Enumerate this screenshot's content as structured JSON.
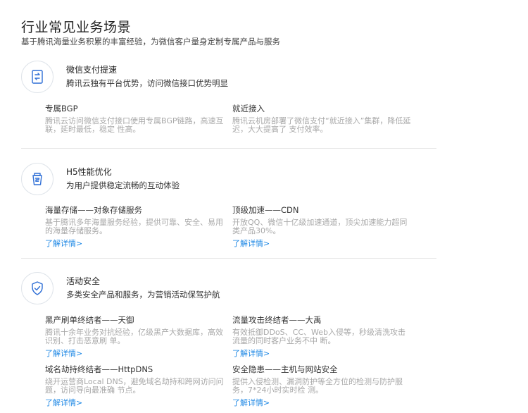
{
  "header": {
    "title": "行业常见业务场景",
    "subtitle": "基于腾讯海量业务积累的丰富经验，为微信客户量身定制专属产品与服务"
  },
  "sections": [
    {
      "icon": "wechat-pay-icon",
      "title": "微信支付提速",
      "desc": "腾讯云独有平台优势，访问微信接口优势明显",
      "features": [
        {
          "title": "专属BGP",
          "desc": "腾讯云访问微信支付接口使用专属BGP链路，高速互联，延时最低，稳定 性高。"
        },
        {
          "title": "就近接入",
          "desc": "腾讯云机房部署了微信支付“就近接入”集群，降低延迟，大大提高了 支付效率。"
        }
      ]
    },
    {
      "icon": "h5-cup-icon",
      "title": "H5性能优化",
      "desc": "为用户提供稳定流畅的互动体验",
      "features": [
        {
          "title": "海量存储——对象存储服务",
          "desc": "基于腾讯多年海量服务经验，提供可靠、安全、易用的海量存储服务。",
          "link": "了解详情>"
        },
        {
          "title": "顶级加速——CDN",
          "desc": "开放QQ、微信十亿级加速通道，顶尖加速能力超同类产品30%。",
          "link": "了解详情>"
        }
      ]
    },
    {
      "icon": "shield-check-icon",
      "title": "活动安全",
      "desc": "多类安全产品和服务，为营销活动保驾护航",
      "features": [
        {
          "title": "黑产刷单终结者——天御",
          "desc": "腾讯十余年业务对抗经验，亿级黑产大数据库，高效识别、打击恶意刷 单。",
          "link": "了解详情>"
        },
        {
          "title": "流量攻击终结者——大禹",
          "desc": "有效抵御DDoS、CC、Web入侵等，秒级清洗攻击流量的同时客户业务不中 断。",
          "link": "了解详情>"
        },
        {
          "title": "域名劫持终结者——HttpDNS",
          "desc": "绕开运营商Local DNS，避免域名劫持和跨网访问问题，访问导向最准确 节点。",
          "link": "了解详情>"
        },
        {
          "title": "安全隐患——主机与网站安全",
          "desc": "提供入侵检测、漏洞防护等全方位的检测与防护服务，7*24小时实时检 测。",
          "link": "了解详情>"
        }
      ]
    }
  ],
  "colors": {
    "accent": "#1e88e5",
    "icon_stroke": "#2f6fd6",
    "muted_text": "#a8a8a8"
  }
}
